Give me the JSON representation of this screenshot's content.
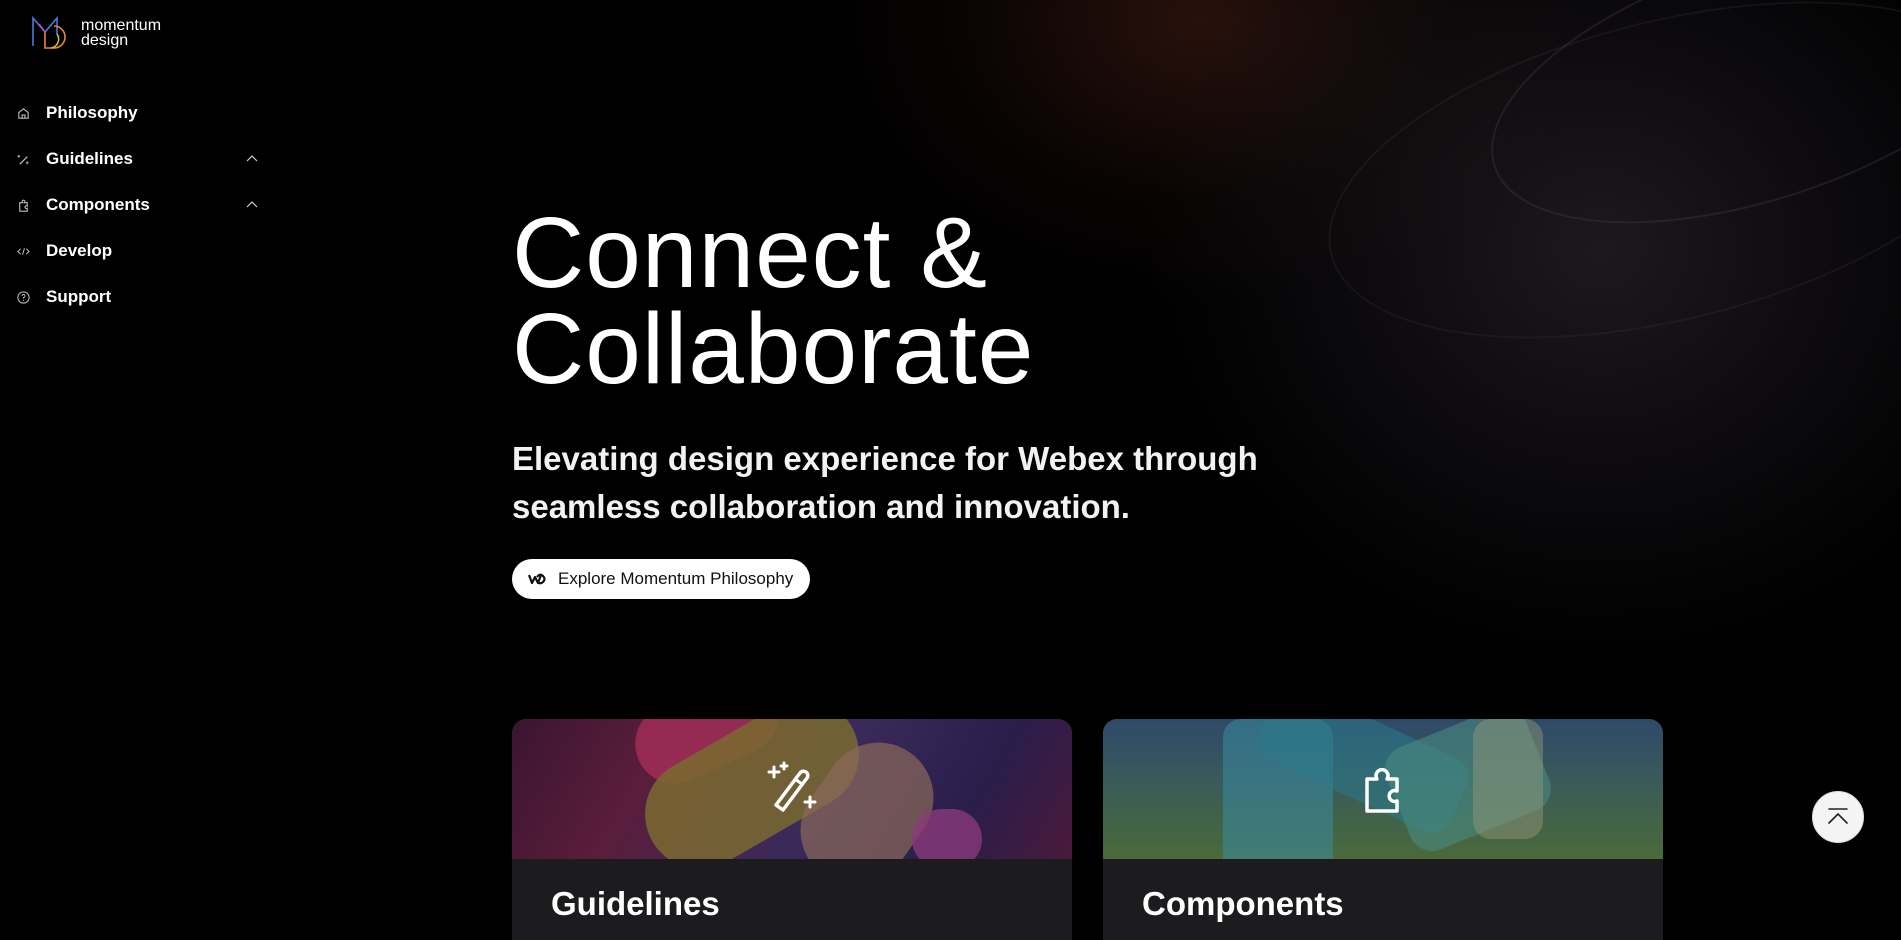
{
  "brand": {
    "line1": "momentum",
    "line2": "design"
  },
  "nav": {
    "items": [
      {
        "label": "Philosophy",
        "icon": "home-icon",
        "expandable": false
      },
      {
        "label": "Guidelines",
        "icon": "magic-wand-icon",
        "expandable": true
      },
      {
        "label": "Components",
        "icon": "puzzle-icon",
        "expandable": true
      },
      {
        "label": "Develop",
        "icon": "code-icon",
        "expandable": false
      },
      {
        "label": "Support",
        "icon": "help-circle-icon",
        "expandable": false
      }
    ]
  },
  "hero": {
    "title_line1": "Connect &",
    "title_line2": "Collaborate",
    "subtitle": "Elevating design experience for Webex through seamless collaboration and innovation.",
    "cta_label": "Explore Momentum Philosophy",
    "cta_icon": "webex-logo-icon"
  },
  "cards": [
    {
      "title": "Guidelines",
      "icon": "magic-wand-icon"
    },
    {
      "title": "Components",
      "icon": "puzzle-icon"
    }
  ],
  "scroll_top": {
    "icon": "back-to-top-icon"
  },
  "colors": {
    "background": "#000000",
    "card": "#1c1c1e",
    "cta_bg": "#ffffff"
  }
}
